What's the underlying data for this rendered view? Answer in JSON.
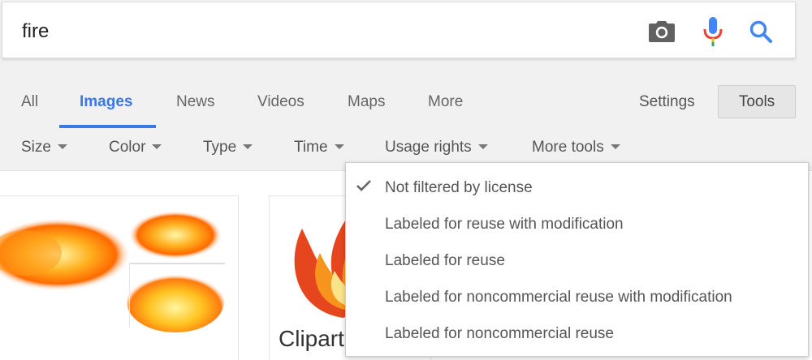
{
  "search": {
    "query": "fire",
    "camera_icon": "camera-icon",
    "mic_icon": "microphone-icon",
    "search_icon": "search-icon"
  },
  "tabs": [
    {
      "label": "All",
      "active": false
    },
    {
      "label": "Images",
      "active": true
    },
    {
      "label": "News",
      "active": false
    },
    {
      "label": "Videos",
      "active": false
    },
    {
      "label": "Maps",
      "active": false
    },
    {
      "label": "More",
      "active": false
    }
  ],
  "settings_label": "Settings",
  "tools_label": "Tools",
  "tools_row": [
    {
      "label": "Size"
    },
    {
      "label": "Color"
    },
    {
      "label": "Type"
    },
    {
      "label": "Time"
    },
    {
      "label": "Usage rights"
    },
    {
      "label": "More tools"
    }
  ],
  "dropdown": {
    "items": [
      {
        "label": "Not filtered by license",
        "checked": true
      },
      {
        "label": "Labeled for reuse with modification",
        "checked": false
      },
      {
        "label": "Labeled for reuse",
        "checked": false
      },
      {
        "label": "Labeled for noncommercial reuse with modification",
        "checked": false
      },
      {
        "label": "Labeled for noncommercial reuse",
        "checked": false
      }
    ]
  },
  "results": {
    "card2_caption": "Clipart"
  },
  "colors": {
    "accent": "#3b78e7",
    "mic_blue": "#4285f4",
    "mic_red": "#ea4335",
    "mic_yellow": "#fbbc05",
    "mic_green": "#34a853"
  }
}
